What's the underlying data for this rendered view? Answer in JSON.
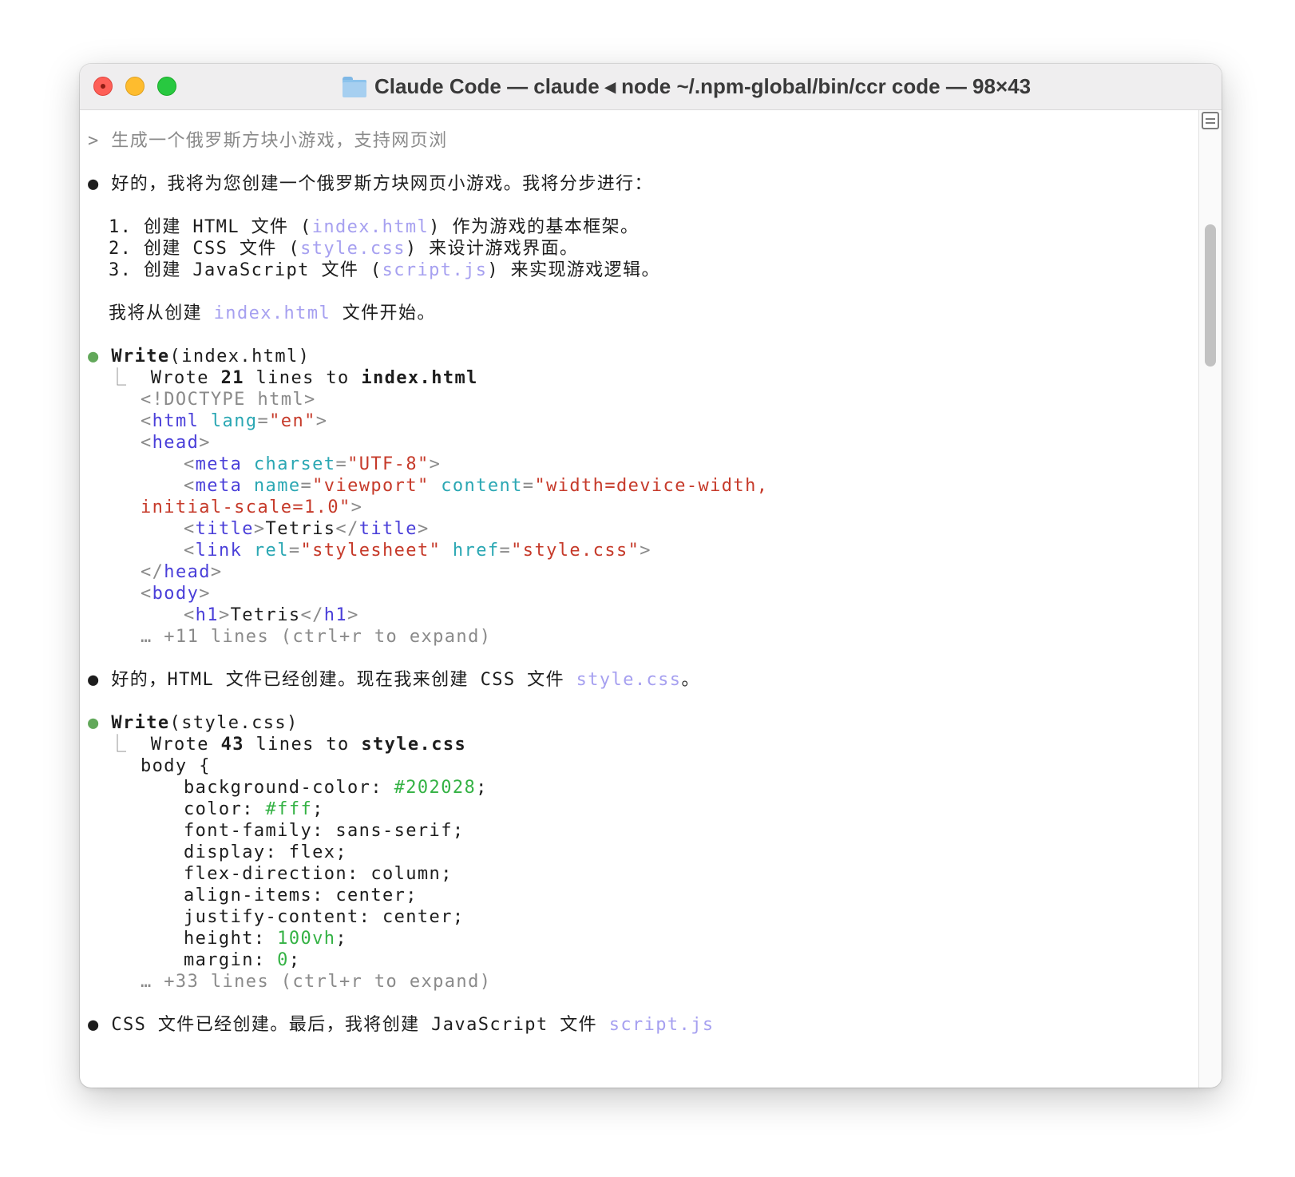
{
  "window": {
    "title": "Claude Code — claude ◂ node ~/.npm-global/bin/ccr code — 98×43"
  },
  "transcript": {
    "prompt": "> 生成一个俄罗斯方块小游戏，支持网页浏",
    "msg1": "好的，我将为您创建一个俄罗斯方块网页小游戏。我将分步进行：",
    "plan": [
      {
        "pre": "1. 创建 HTML 文件 (",
        "file": "index.html",
        "post": ") 作为游戏的基本框架。"
      },
      {
        "pre": "2. 创建 CSS 文件 (",
        "file": "style.css",
        "post": ") 来设计游戏界面。"
      },
      {
        "pre": "3. 创建 JavaScript 文件 (",
        "file": "script.js",
        "post": ") 来实现游戏逻辑。"
      }
    ],
    "start": {
      "pre": "我将从创建 ",
      "file": "index.html",
      "post": " 文件开始。"
    },
    "tool1": {
      "name": "Write",
      "arg": "(index.html)",
      "result_pre": "Wrote ",
      "count": "21",
      "result_mid": " lines to ",
      "target": "index.html",
      "more": "… +11 lines (ctrl+r to expand)"
    },
    "html_code": {
      "doctype": "<!DOCTYPE html>",
      "html_tag": "html",
      "lang_attr": "lang",
      "lang_val": "\"en\"",
      "head": "head",
      "meta": "meta",
      "charset_attr": "charset",
      "charset_val": "\"UTF-8\"",
      "name_attr": "name",
      "name_val": "\"viewport\"",
      "content_attr": "content",
      "content_val1": "\"width=device-width,",
      "content_val2": "initial-scale=1.0\"",
      "title_tag": "title",
      "title_text": "Tetris",
      "link_tag": "link",
      "rel_attr": "rel",
      "rel_val": "\"stylesheet\"",
      "href_attr": "href",
      "href_val": "\"style.css\"",
      "body_tag": "body",
      "h1_tag": "h1",
      "h1_text": "Tetris"
    },
    "msg2": {
      "pre": "好的，HTML 文件已经创建。现在我来创建 CSS 文件 ",
      "file": "style.css",
      "post": "。"
    },
    "tool2": {
      "name": "Write",
      "arg": "(style.css)",
      "result_pre": "Wrote ",
      "count": "43",
      "result_mid": " lines to ",
      "target": "style.css",
      "more": "… +33 lines (ctrl+r to expand)"
    },
    "css_code": {
      "selector": "body {",
      "bg_prop": "background-color: ",
      "bg_val": "#202028",
      "color_prop": "color: ",
      "color_val": "#fff",
      "ff": "font-family: sans-serif;",
      "display": "display: flex;",
      "fd": "flex-direction: column;",
      "ai": "align-items: center;",
      "jc": "justify-content: center;",
      "height_prop": "height: ",
      "height_val": "100vh",
      "margin_prop": "margin: ",
      "margin_val": "0"
    },
    "msg3": {
      "pre": "CSS 文件已经创建。最后，我将创建 JavaScript 文件 ",
      "file": "script.js"
    },
    "bullet": "●",
    "tree": "⎿ ",
    "semicolon": ";"
  },
  "colors": {
    "link": "#a6a0f0",
    "tag": "#4a3fd9",
    "attr": "#2aa7b3",
    "string": "#c63a2a",
    "number": "#34b244",
    "bullet_green": "#62a85a"
  }
}
